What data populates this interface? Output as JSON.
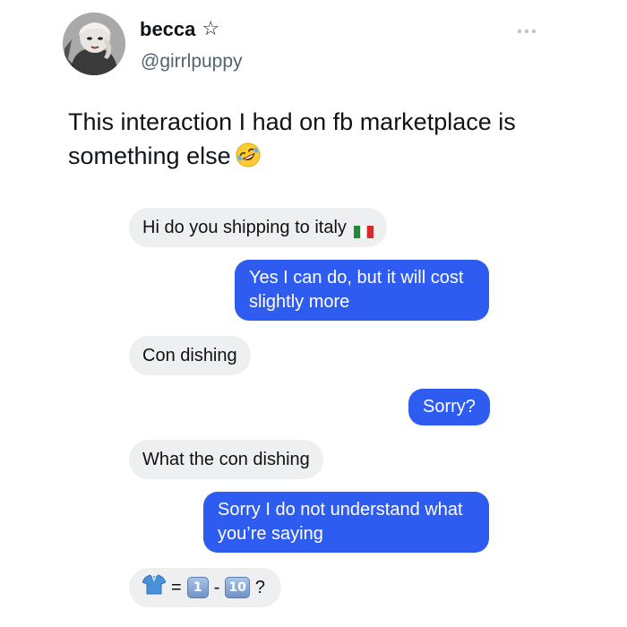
{
  "tweet": {
    "display_name": "becca",
    "badge_icon": "star-outline-icon",
    "handle": "@girrlpuppy",
    "more_icon": "more-dots-icon",
    "text": "This interaction I had on fb marketplace is something else",
    "text_emoji": "rolling-on-floor-laughing-icon"
  },
  "conversation": {
    "messages": [
      {
        "side": "incoming",
        "text": "Hi do you shipping to italy",
        "trailing_icon": "italy-flag-icon"
      },
      {
        "side": "outgoing",
        "text": "Yes I can do, but it will cost slightly more"
      },
      {
        "side": "incoming",
        "text": "Con dishing"
      },
      {
        "side": "outgoing",
        "text": "Sorry?"
      },
      {
        "side": "incoming",
        "text": "What the con dishing"
      },
      {
        "side": "outgoing",
        "text": "Sorry I do not understand what you’re saying"
      },
      {
        "side": "incoming",
        "emoji_sequence": [
          "tshirt-icon",
          "=",
          "1",
          "-",
          "10",
          "?"
        ]
      }
    ]
  },
  "colors": {
    "outgoing_bubble": "#2f5cf0",
    "incoming_bubble": "#eeeff1",
    "handle_text": "#536471"
  }
}
